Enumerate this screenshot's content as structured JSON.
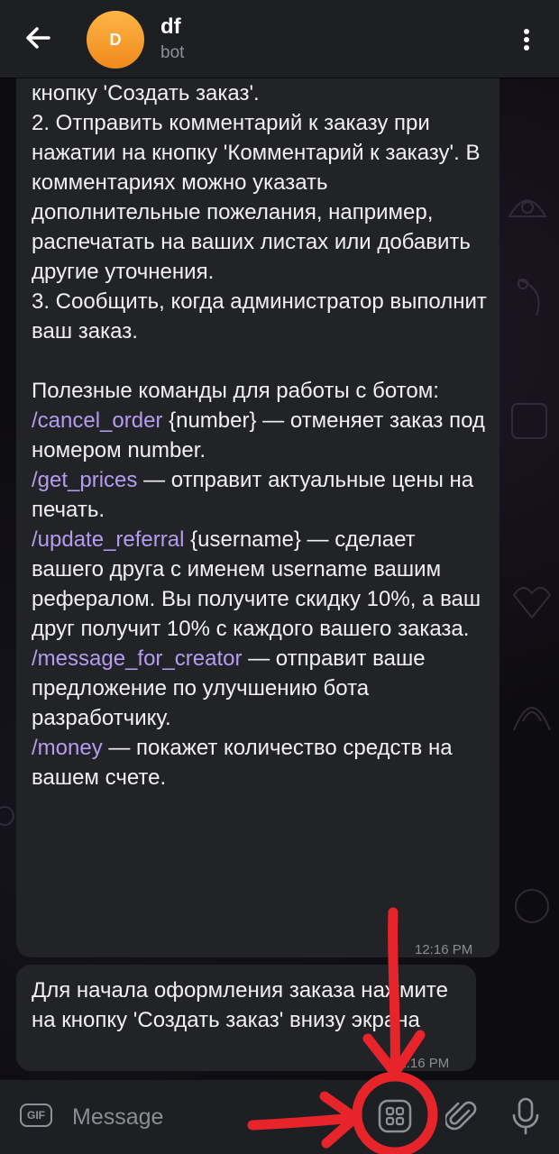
{
  "header": {
    "title": "df",
    "subtitle": "bot",
    "avatar_letter": "D",
    "avatar_color": "#f59a2a"
  },
  "message1": {
    "lines": [
      {
        "parts": [
          {
            "text": "кнопку 'Создать заказ'."
          }
        ]
      },
      {
        "parts": [
          {
            "text": "2. Отправить комментарий к заказу при нажатии на кнопку 'Комментарий к заказу'. В комментариях можно указать дополнительные пожелания, например, распечатать на ваших листах или добавить другие уточнения."
          }
        ]
      },
      {
        "parts": [
          {
            "text": "3. Сообщить, когда администратор выполнит ваш заказ."
          }
        ]
      },
      {
        "parts": [
          {
            "text": ""
          }
        ]
      },
      {
        "parts": [
          {
            "text": "Полезные команды для работы с ботом:"
          }
        ]
      },
      {
        "parts": [
          {
            "cmd": "/cancel_order"
          },
          {
            "text": " {number} — отменяет заказ под номером number."
          }
        ]
      },
      {
        "parts": [
          {
            "cmd": "/get_prices"
          },
          {
            "text": " — отправит актуальные цены на печать."
          }
        ]
      },
      {
        "parts": [
          {
            "cmd": "/update_referral"
          },
          {
            "text": " {username} — сделает вашего друга с именем username вашим рефералом. Вы получите скидку 10%, а ваш друг получит 10% с каждого вашего заказа."
          }
        ]
      },
      {
        "parts": [
          {
            "cmd": "/message_for_creator"
          },
          {
            "text": " — отправит ваше предложение по улучшению бота разработчику."
          }
        ]
      },
      {
        "parts": [
          {
            "cmd": "/money"
          },
          {
            "text": " — покажет количество средств на вашем счете."
          }
        ]
      }
    ],
    "time": "12:16 PM"
  },
  "message2": {
    "text": "Для начала оформления заказа нажмите на кнопку 'Создать заказ' внизу экрана",
    "time": "12:16 PM"
  },
  "input": {
    "placeholder": "Message",
    "gif_label": "GIF"
  },
  "colors": {
    "command": "#b59cf0",
    "annotation": "#e8242b",
    "bubble": "#222326",
    "bar": "#1e1f23"
  },
  "icons": [
    "back-arrow-icon",
    "more-vert-icon",
    "gif-icon",
    "bot-menu-icon",
    "paperclip-icon",
    "microphone-icon"
  ]
}
